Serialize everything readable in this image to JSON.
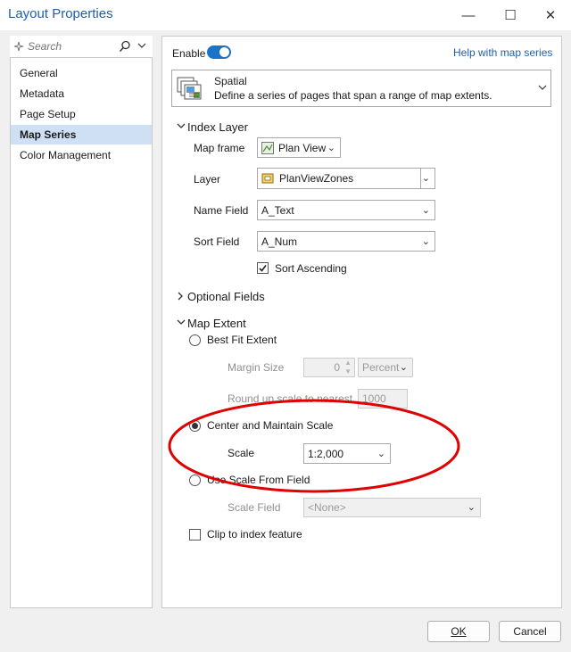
{
  "window": {
    "title": "Layout Properties",
    "minimize_glyph": "—",
    "maximize_glyph": "☐",
    "close_glyph": "✕"
  },
  "sidebar": {
    "search_placeholder": "Search",
    "items": [
      {
        "label": "General"
      },
      {
        "label": "Metadata"
      },
      {
        "label": "Page Setup"
      },
      {
        "label": "Map Series",
        "selected": true
      },
      {
        "label": "Color Management"
      }
    ]
  },
  "top": {
    "enable_label": "Enable",
    "enabled": true,
    "help_link": "Help with map series"
  },
  "series_type": {
    "title": "Spatial",
    "description": "Define a series of pages that span a range of map extents."
  },
  "index_layer": {
    "header": "Index Layer",
    "map_frame_label": "Map frame",
    "map_frame_value": "Plan View",
    "layer_label": "Layer",
    "layer_value": "PlanViewZones",
    "name_field_label": "Name Field",
    "name_field_value": "A_Text",
    "sort_field_label": "Sort Field",
    "sort_field_value": "A_Num",
    "sort_ascending_label": "Sort Ascending",
    "sort_ascending": true
  },
  "optional_fields": {
    "header": "Optional Fields"
  },
  "map_extent": {
    "header": "Map Extent",
    "best_fit_label": "Best Fit Extent",
    "margin_size_label": "Margin Size",
    "margin_size_value": "0",
    "margin_unit": "Percent",
    "round_up_label": "Round up scale to nearest",
    "round_up_value": "1000",
    "center_label": "Center and Maintain Scale",
    "scale_label": "Scale",
    "scale_value": "1:2,000",
    "use_scale_field_label": "Use Scale From Field",
    "scale_field_label": "Scale Field",
    "scale_field_value": "<None>",
    "clip_label": "Clip to index feature",
    "selected_option": "Center and Maintain Scale"
  },
  "footer": {
    "ok_label": "OK",
    "cancel_label": "Cancel"
  },
  "colors": {
    "accent": "#1f5fa6",
    "toggle": "#1a73c9",
    "annotation": "#e00000",
    "selection": "#cfe0f4"
  }
}
